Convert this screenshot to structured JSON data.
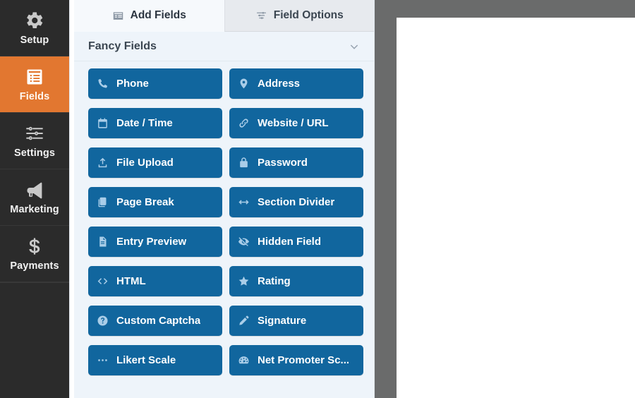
{
  "sidebar": {
    "items": [
      {
        "label": "Setup",
        "icon": "gear-icon",
        "active": false
      },
      {
        "label": "Fields",
        "icon": "form-list-icon",
        "active": true
      },
      {
        "label": "Settings",
        "icon": "sliders-icon",
        "active": false
      },
      {
        "label": "Marketing",
        "icon": "megaphone-icon",
        "active": false
      },
      {
        "label": "Payments",
        "icon": "dollar-icon",
        "active": false
      }
    ],
    "active_color": "#e27730",
    "background_color": "#2b2b2b"
  },
  "panel": {
    "tabs": [
      {
        "label": "Add Fields",
        "icon": "add-fields-icon",
        "active": true
      },
      {
        "label": "Field Options",
        "icon": "field-options-icon",
        "active": false
      }
    ],
    "section": {
      "title": "Fancy Fields",
      "collapse_icon": "chevron-down-icon",
      "expanded": true
    },
    "fields": [
      {
        "label": "Phone",
        "icon": "phone-icon"
      },
      {
        "label": "Address",
        "icon": "map-pin-icon"
      },
      {
        "label": "Date / Time",
        "icon": "calendar-icon"
      },
      {
        "label": "Website / URL",
        "icon": "link-icon"
      },
      {
        "label": "File Upload",
        "icon": "upload-icon"
      },
      {
        "label": "Password",
        "icon": "lock-icon"
      },
      {
        "label": "Page Break",
        "icon": "pages-icon"
      },
      {
        "label": "Section Divider",
        "icon": "arrows-horizontal-icon"
      },
      {
        "label": "Entry Preview",
        "icon": "document-icon"
      },
      {
        "label": "Hidden Field",
        "icon": "eye-slash-icon"
      },
      {
        "label": "HTML",
        "icon": "code-icon"
      },
      {
        "label": "Rating",
        "icon": "star-icon"
      },
      {
        "label": "Custom Captcha",
        "icon": "question-circle-icon"
      },
      {
        "label": "Signature",
        "icon": "pencil-icon"
      },
      {
        "label": "Likert Scale",
        "icon": "ellipsis-icon"
      },
      {
        "label": "Net Promoter Sc...",
        "icon": "speedometer-icon"
      }
    ],
    "button_color": "#11669e",
    "background_color": "#eef4fa"
  },
  "preview": {
    "chrome_color": "#6a6b6b",
    "sheet_color": "#ffffff"
  }
}
